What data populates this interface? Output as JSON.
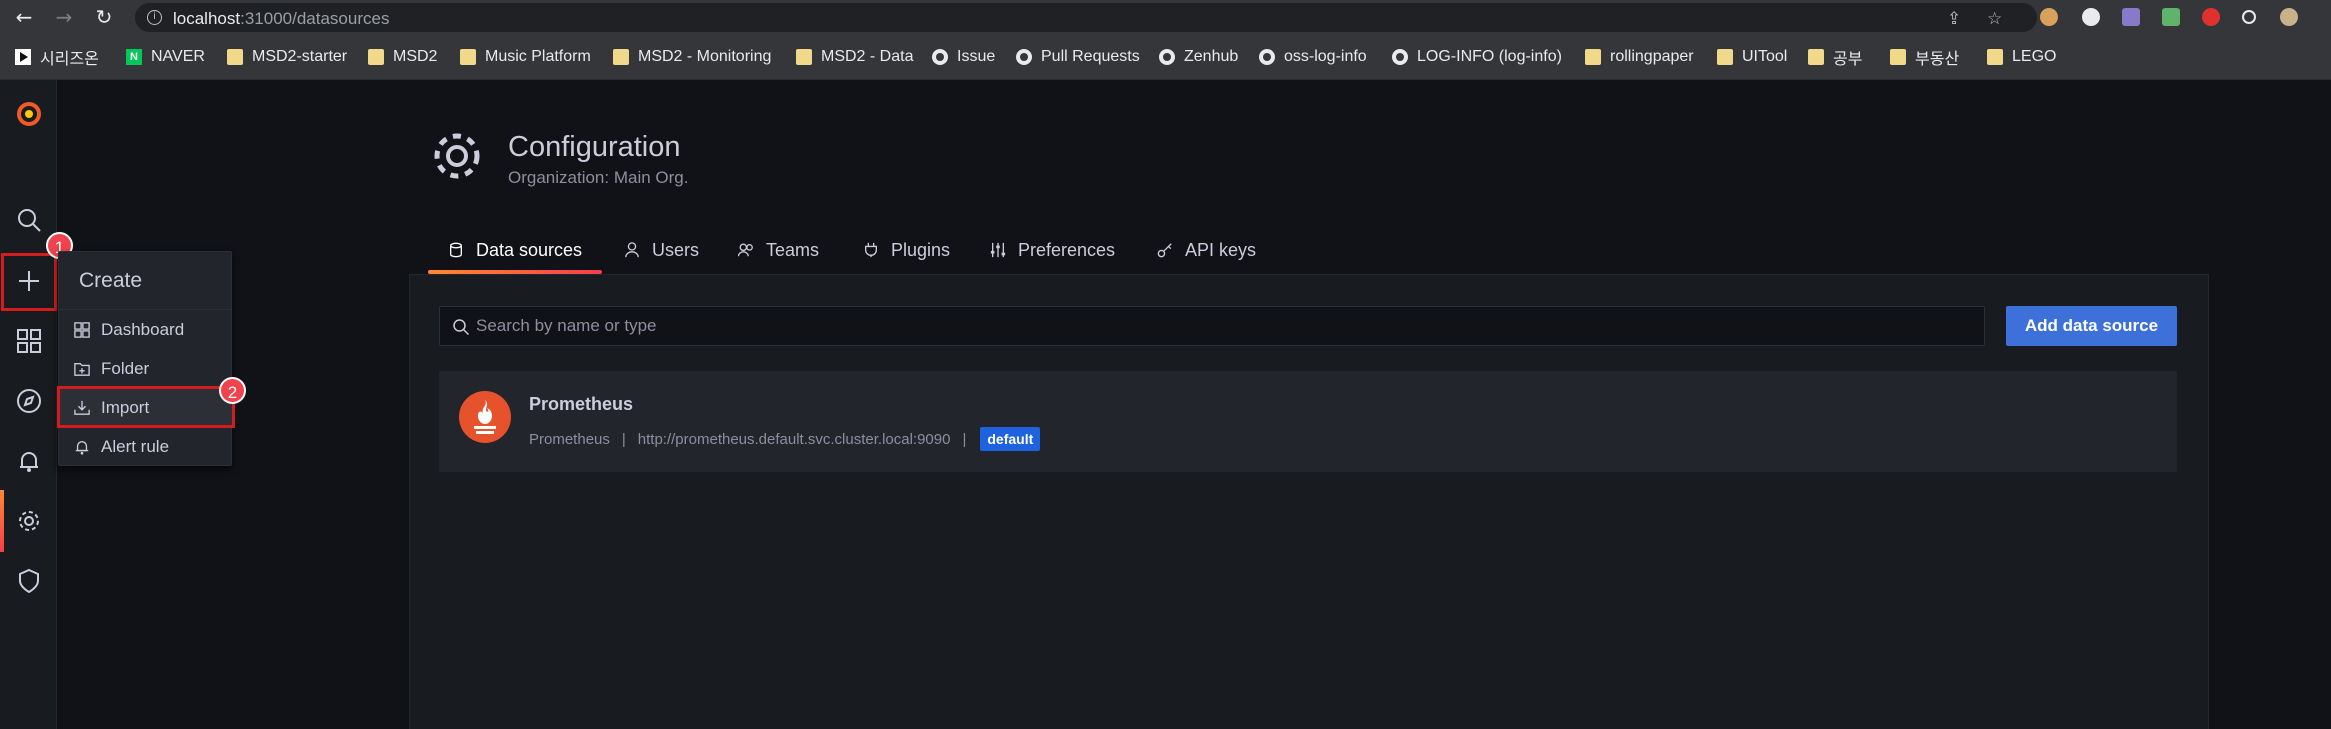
{
  "browser": {
    "url_host": "localhost",
    "url_path": ":31000/datasources",
    "bookmarks": [
      {
        "label": "시리즈온",
        "icon": "series-icon"
      },
      {
        "label": "NAVER",
        "icon": "naver-icon"
      },
      {
        "label": "MSD2-starter",
        "icon": "folder-icon"
      },
      {
        "label": "MSD2",
        "icon": "folder-icon"
      },
      {
        "label": "Music Platform",
        "icon": "folder-icon"
      },
      {
        "label": "MSD2 - Monitoring",
        "icon": "folder-icon"
      },
      {
        "label": "MSD2 - Data",
        "icon": "folder-icon"
      },
      {
        "label": "Issue",
        "icon": "github-icon"
      },
      {
        "label": "Pull Requests",
        "icon": "github-icon"
      },
      {
        "label": "Zenhub",
        "icon": "github-icon"
      },
      {
        "label": "oss-log-info",
        "icon": "github-icon"
      },
      {
        "label": "LOG-INFO (log-info)",
        "icon": "github-icon"
      },
      {
        "label": "rollingpaper",
        "icon": "folder-icon"
      },
      {
        "label": "UITool",
        "icon": "folder-icon"
      },
      {
        "label": "공부",
        "icon": "folder-icon"
      },
      {
        "label": "부동산",
        "icon": "folder-icon"
      },
      {
        "label": "LEGO",
        "icon": "folder-icon"
      }
    ]
  },
  "annotations": {
    "step1": "1",
    "step2": "2"
  },
  "create_menu": {
    "title": "Create",
    "items": [
      {
        "label": "Dashboard",
        "icon": "dashboard-icon"
      },
      {
        "label": "Folder",
        "icon": "folder-plus-icon"
      },
      {
        "label": "Import",
        "icon": "import-icon"
      },
      {
        "label": "Alert rule",
        "icon": "bell-icon"
      }
    ]
  },
  "page": {
    "title": "Configuration",
    "subtitle": "Organization: Main Org.",
    "tabs": [
      {
        "label": "Data sources",
        "icon": "database-icon",
        "active": true
      },
      {
        "label": "Users",
        "icon": "user-icon"
      },
      {
        "label": "Teams",
        "icon": "users-icon"
      },
      {
        "label": "Plugins",
        "icon": "plug-icon"
      },
      {
        "label": "Preferences",
        "icon": "sliders-icon"
      },
      {
        "label": "API keys",
        "icon": "key-icon"
      }
    ],
    "search_placeholder": "Search by name or type",
    "add_button": "Add data source"
  },
  "datasources": [
    {
      "name": "Prometheus",
      "type": "Prometheus",
      "url": "http://prometheus.default.svc.cluster.local:9090",
      "badge": "default"
    }
  ],
  "colors": {
    "accent_orange": "#ff8833",
    "primary_blue": "#3d71d9",
    "prometheus": "#e6522c",
    "highlight_red": "#d31d1d"
  }
}
